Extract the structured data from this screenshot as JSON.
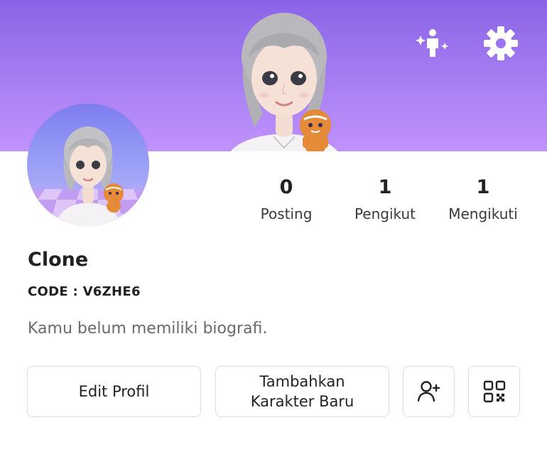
{
  "header": {
    "avatar_style_icon": "avatar-sparkle-icon",
    "settings_icon": "gear-icon"
  },
  "stats": {
    "posts": {
      "count": "0",
      "label": "Posting"
    },
    "followers": {
      "count": "1",
      "label": "Pengikut"
    },
    "following": {
      "count": "1",
      "label": "Mengikuti"
    }
  },
  "profile": {
    "name": "Clone",
    "code": "CODE : V6ZHE6",
    "bio": "Kamu belum memiliki biografi."
  },
  "actions": {
    "edit_label": "Edit Profil",
    "add_character_line1": "Tambahkan",
    "add_character_line2": "Karakter Baru",
    "add_friend_icon": "add-user-icon",
    "qr_icon": "qr-code-icon"
  },
  "colors": {
    "banner_top": "#8a63e6",
    "banner_bottom": "#c192fb",
    "text": "#222222",
    "bio_text": "#6a6a6a",
    "button_border": "#dcdcdc"
  }
}
